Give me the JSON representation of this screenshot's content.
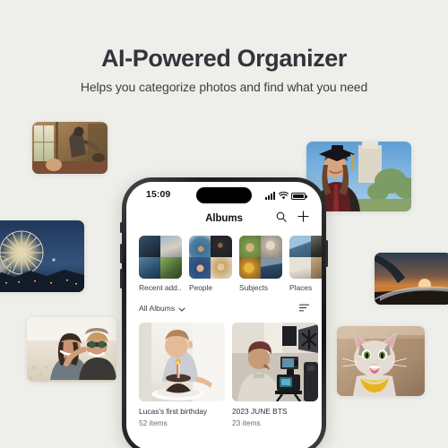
{
  "hero": {
    "title": "AI-Powered Organizer",
    "subtitle": "Helps you categorize photos and find what you need"
  },
  "colors": {
    "background": "#eeeeea",
    "title_text": "#32343a",
    "body_text": "#3e4044",
    "muted_text": "#6b6d72",
    "phone_frame": "#2b2b2d",
    "screen": "#ffffff"
  },
  "phone": {
    "status_bar": {
      "time": "15:09",
      "signal_icon": "cellular-signal-icon",
      "wifi_icon": "wifi-icon",
      "battery_icon": "battery-full-icon",
      "notch": "dynamic-island"
    },
    "nav_bar": {
      "title": "Albums",
      "search_icon": "search-icon",
      "add_icon": "plus-icon"
    },
    "categories": [
      {
        "label": "Recent add...",
        "name": "category-recently-added"
      },
      {
        "label": "People",
        "name": "category-people"
      },
      {
        "label": "Subjects",
        "name": "category-subjects"
      },
      {
        "label": "Places",
        "name": "category-places"
      }
    ],
    "filter": {
      "label": "All Albums",
      "chevron_icon": "chevron-down-icon",
      "sort_icon": "sort-icon"
    },
    "albums": [
      {
        "title": "Lucas's first birthday",
        "count": "52 items"
      },
      {
        "title": "2023 JUNE BTS",
        "count": "23 items"
      }
    ]
  },
  "floating_photos": [
    {
      "name": "photo-child-window",
      "alt": "child by sunlit window"
    },
    {
      "name": "photo-fireworks",
      "alt": "fireworks over night city"
    },
    {
      "name": "photo-two-friends-beach",
      "alt": "two friends smiling at beach"
    },
    {
      "name": "photo-graduate",
      "alt": "graduate in cap and gown"
    },
    {
      "name": "photo-airplane-sunset",
      "alt": "sunset from airplane window"
    },
    {
      "name": "photo-cat-bandana",
      "alt": "cat with yellow bandana"
    }
  ]
}
